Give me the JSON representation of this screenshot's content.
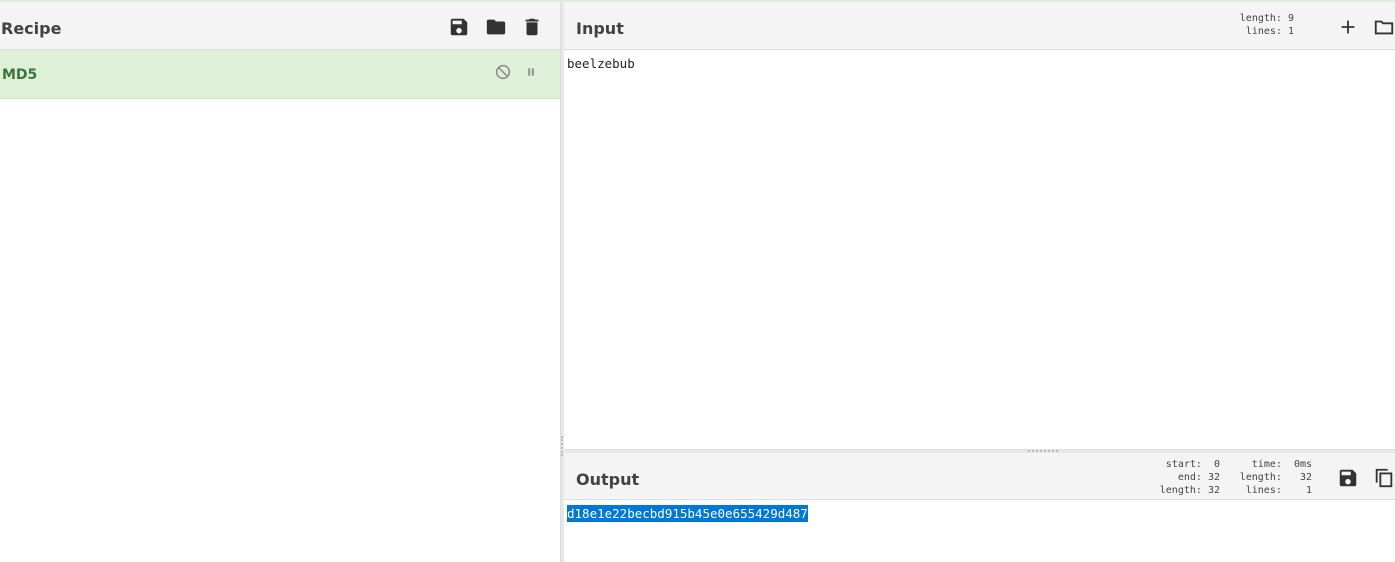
{
  "recipe": {
    "title": "Recipe",
    "operation": {
      "name": "MD5"
    },
    "icons": {
      "save": "save-icon",
      "load": "folder-icon",
      "clear": "trash-icon",
      "disable": "disable-icon",
      "breakpoint": "pause-icon"
    }
  },
  "input": {
    "title": "Input",
    "stats": {
      "length_label": "length:",
      "length": "9",
      "lines_label": "lines:",
      "lines": "1"
    },
    "text": "beelzebub",
    "icons": {
      "add": "plus-icon",
      "open": "folder-icon"
    }
  },
  "output": {
    "title": "Output",
    "stats": {
      "start_label": "start:",
      "start": "0",
      "end_label": "end:",
      "end": "32",
      "length_label": "length:",
      "length": "32",
      "time_label": "time:",
      "time": "0ms",
      "length2_label": "length:",
      "length2": "32",
      "lines_label": "lines:",
      "lines": "1"
    },
    "text": "d18e1e22becbd915b45e0e655429d487",
    "icons": {
      "save": "save-icon",
      "copy": "copy-icon"
    }
  },
  "colors": {
    "accent_green": "#3c763d",
    "op_background": "#dff0d8",
    "selection": "#0078d7"
  }
}
